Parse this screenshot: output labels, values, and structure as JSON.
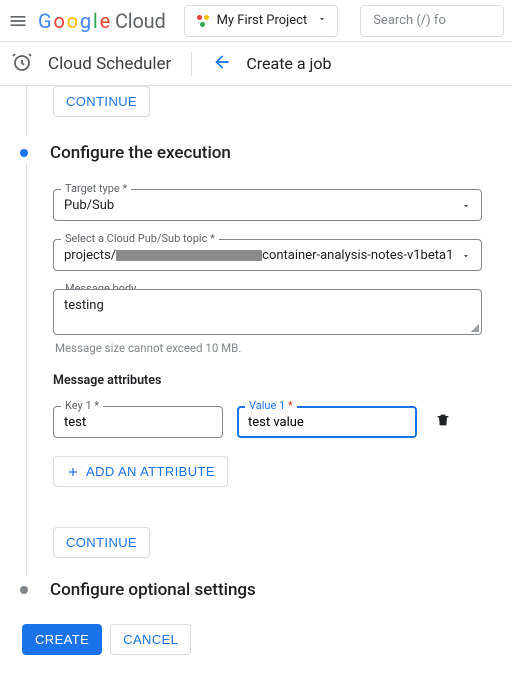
{
  "header": {
    "brand_cloud": "Cloud",
    "project_name": "My First Project",
    "search_placeholder": "Search (/) fo"
  },
  "subheader": {
    "product": "Cloud Scheduler",
    "page": "Create a job"
  },
  "prev_step": {
    "continue": "CONTINUE"
  },
  "exec": {
    "title": "Configure the execution",
    "target_type_label": "Target type",
    "target_type_value": "Pub/Sub",
    "topic_label": "Select a Cloud Pub/Sub topic",
    "topic_prefix": "projects/",
    "topic_suffix": "container-analysis-notes-v1beta1",
    "body_label": "Message body",
    "body_value": "testing",
    "body_helper": "Message size cannot exceed 10 MB.",
    "attributes_title": "Message attributes",
    "key_label": "Key 1",
    "key_value": "test",
    "value_label": "Value 1",
    "value_value": "test value",
    "add_attr": "ADD AN ATTRIBUTE",
    "continue": "CONTINUE"
  },
  "optional": {
    "title": "Configure optional settings"
  },
  "footer": {
    "create": "CREATE",
    "cancel": "CANCEL"
  }
}
